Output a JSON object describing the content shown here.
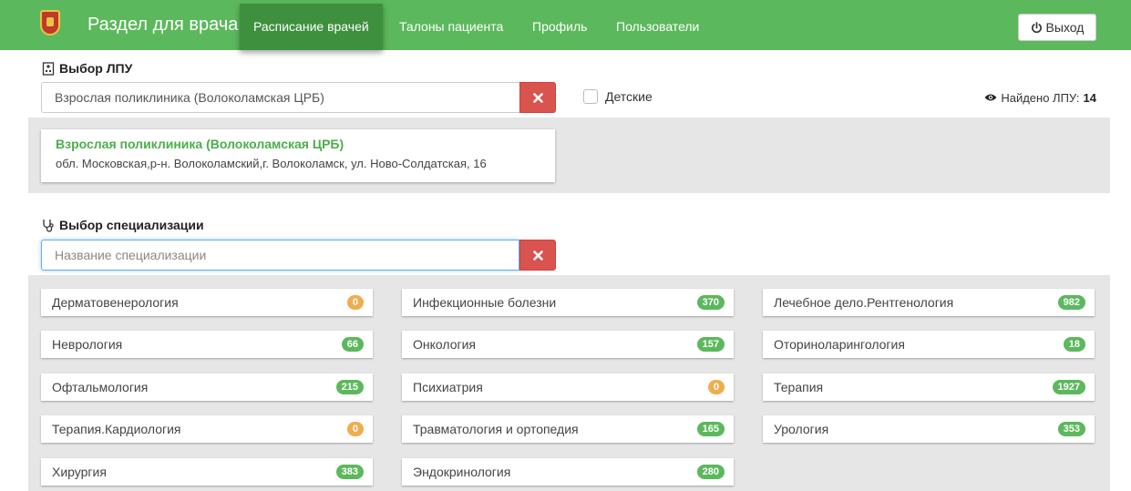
{
  "navbar": {
    "brand": "Раздел для врача",
    "items": [
      {
        "label": "Расписание врачей",
        "active": true
      },
      {
        "label": "Талоны пациента"
      },
      {
        "label": "Профиль"
      },
      {
        "label": "Пользователи"
      }
    ],
    "logout": "Выход"
  },
  "lpu_section": {
    "title": "Выбор ЛПУ",
    "input_value": "Взрослая поликлиника (Волоколамская ЦРБ)",
    "children_checkbox": "Детские",
    "found_label": "Найдено ЛПУ:",
    "found_count": "14",
    "result": {
      "name": "Взрослая поликлиника (Волоколамская ЦРБ)",
      "address": "обл. Московская,р-н. Волоколамский,г. Волоколамск, ул. Ново-Солдатская, 16"
    }
  },
  "spec_section": {
    "title": "Выбор специализации",
    "placeholder": "Название специализации",
    "items": [
      {
        "label": "Дерматовенерология",
        "count": "0",
        "status": "orange"
      },
      {
        "label": "Инфекционные болезни",
        "count": "370",
        "status": "green"
      },
      {
        "label": "Лечебное дело.Рентгенология",
        "count": "982",
        "status": "green"
      },
      {
        "label": "Неврология",
        "count": "66",
        "status": "green"
      },
      {
        "label": "Онкология",
        "count": "157",
        "status": "green"
      },
      {
        "label": "Оториноларингология",
        "count": "18",
        "status": "green"
      },
      {
        "label": "Офтальмология",
        "count": "215",
        "status": "green"
      },
      {
        "label": "Психиатрия",
        "count": "0",
        "status": "orange"
      },
      {
        "label": "Терапия",
        "count": "1927",
        "status": "green"
      },
      {
        "label": "Терапия.Кардиология",
        "count": "0",
        "status": "orange"
      },
      {
        "label": "Травматология и ортопедия",
        "count": "165",
        "status": "green"
      },
      {
        "label": "Урология",
        "count": "353",
        "status": "green"
      },
      {
        "label": "Хирургия",
        "count": "383",
        "status": "green"
      },
      {
        "label": "Эндокринология",
        "count": "280",
        "status": "green"
      }
    ]
  },
  "colors": {
    "brand_green": "#5cb85c",
    "active_nav": "#3e8f3e",
    "danger": "#d9534f",
    "badge_green": "#5cb85c",
    "badge_orange": "#f0ad4e"
  },
  "icons": [
    "logo-emblem",
    "power-icon",
    "hospital-icon",
    "stethoscope-icon",
    "eye-icon",
    "close-icon"
  ]
}
